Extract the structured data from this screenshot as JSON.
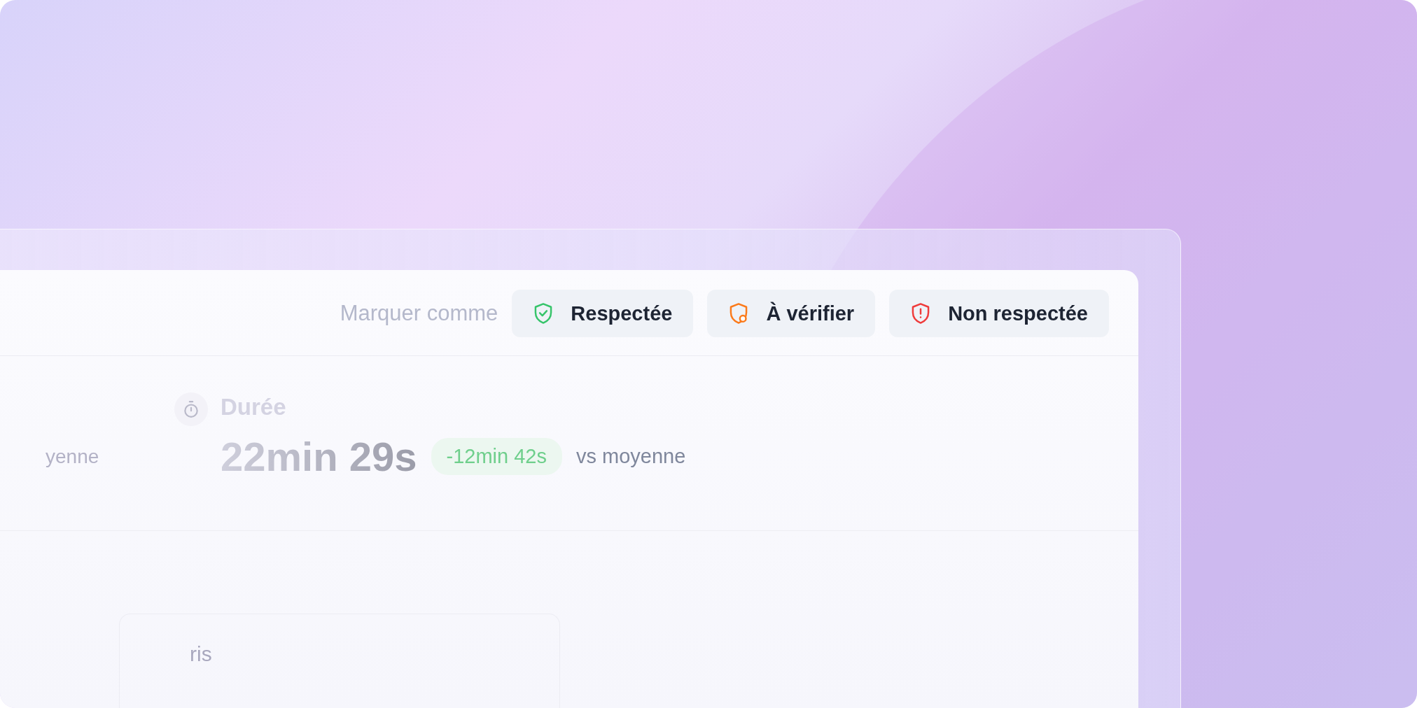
{
  "header": {
    "label": "Marquer comme",
    "buttons": [
      {
        "kind": "ok",
        "label": "Respectée"
      },
      {
        "kind": "check",
        "label": "À vérifier"
      },
      {
        "kind": "bad",
        "label": "Non respectée"
      }
    ]
  },
  "side_label": "yenne",
  "duration": {
    "title": "Durée",
    "value": "22min 29s",
    "delta": "-12min 42s",
    "comparison": "vs moyenne"
  },
  "section_title": "ris"
}
